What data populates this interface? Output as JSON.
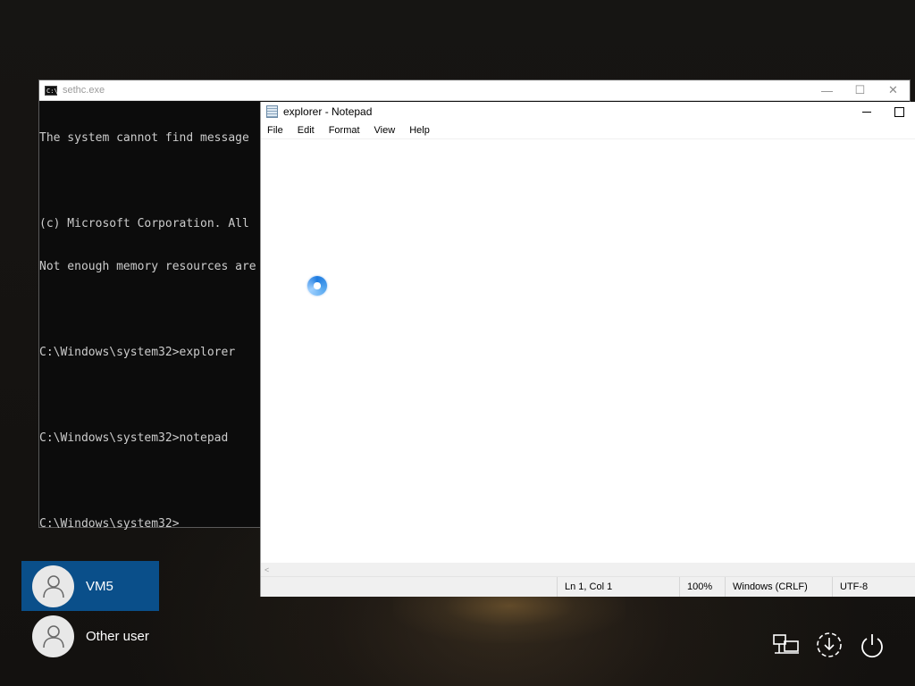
{
  "cmd": {
    "title": "sethc.exe",
    "icon_text": "C:\\",
    "lines": [
      "The system cannot find message",
      "",
      "(c) Microsoft Corporation. All",
      "Not enough memory resources are",
      "",
      "C:\\Windows\\system32>explorer",
      "",
      "C:\\Windows\\system32>notepad",
      "",
      "C:\\Windows\\system32>"
    ],
    "minimize_glyph": "—",
    "maximize_glyph": "☐",
    "close_glyph": "✕"
  },
  "notepad": {
    "title": "explorer - Notepad",
    "menu": [
      "File",
      "Edit",
      "Format",
      "View",
      "Help"
    ],
    "status": {
      "position": "Ln 1, Col 1",
      "zoom": "100%",
      "line_ending": "Windows (CRLF)",
      "encoding": "UTF-8"
    },
    "scroll_left_glyph": "<"
  },
  "users": {
    "selected": "VM5",
    "other": "Other user"
  },
  "colors": {
    "accent": "#0a4f8a",
    "spinner": "#1e7be0"
  },
  "icons": [
    "network-icon",
    "accessibility-icon",
    "power-icon"
  ]
}
